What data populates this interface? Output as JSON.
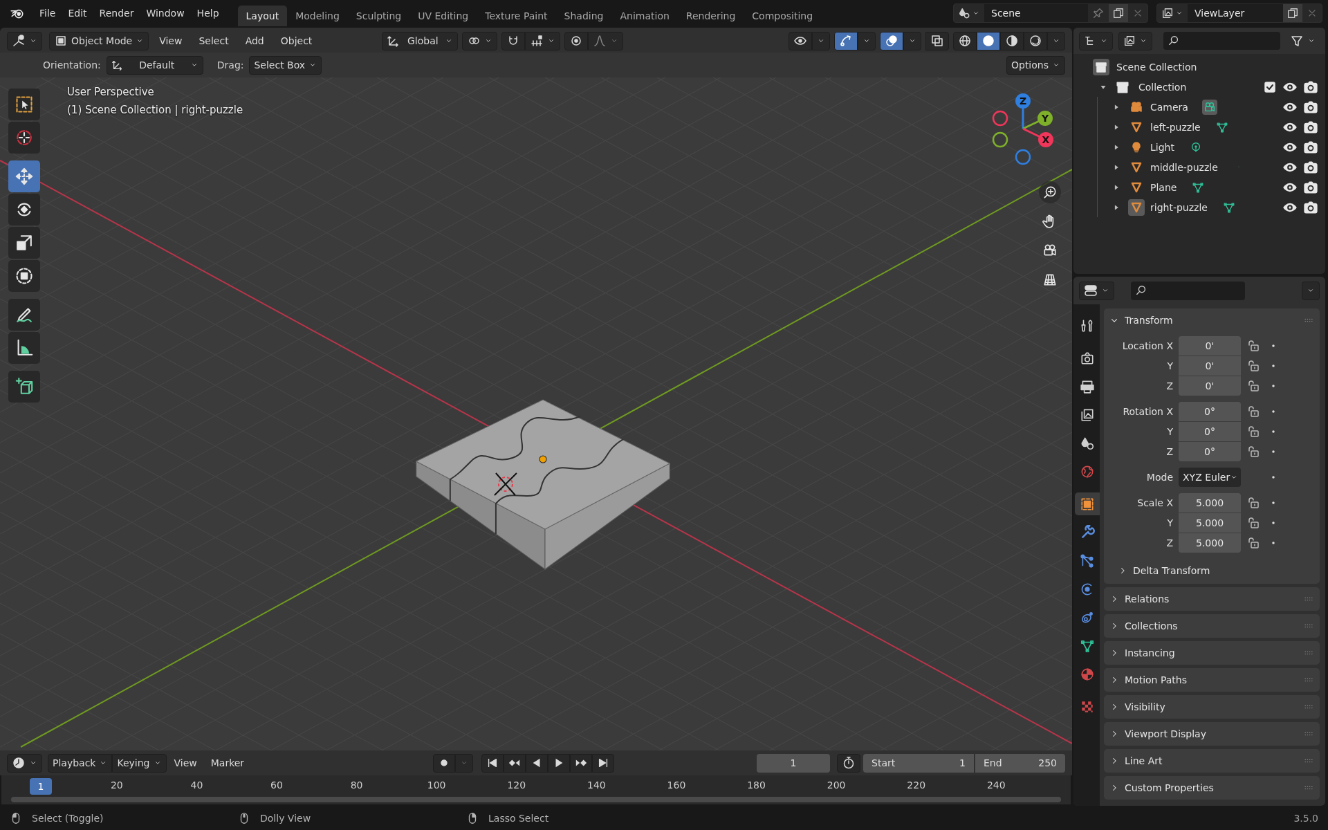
{
  "topbar": {
    "menus": [
      "File",
      "Edit",
      "Render",
      "Window",
      "Help"
    ],
    "workspaces": [
      {
        "label": "Layout",
        "selected": true
      },
      {
        "label": "Modeling",
        "selected": false
      },
      {
        "label": "Sculpting",
        "selected": false
      },
      {
        "label": "UV Editing",
        "selected": false
      },
      {
        "label": "Texture Paint",
        "selected": false
      },
      {
        "label": "Shading",
        "selected": false
      },
      {
        "label": "Animation",
        "selected": false
      },
      {
        "label": "Rendering",
        "selected": false
      },
      {
        "label": "Compositing",
        "selected": false
      }
    ],
    "scene": "Scene",
    "view_layer": "ViewLayer"
  },
  "viewport": {
    "header": {
      "mode": "Object Mode",
      "menus": [
        "View",
        "Select",
        "Add",
        "Object"
      ],
      "orientation": "Global",
      "snap": {
        "on": false
      },
      "proportional": {
        "on": false
      },
      "toggles": [
        {
          "kind": "visibility",
          "on": false
        },
        {
          "kind": "gizmo",
          "on": true
        },
        {
          "kind": "overlay",
          "on": true
        },
        {
          "kind": "xray",
          "on": false
        }
      ],
      "shading": [
        {
          "kind": "wireframe",
          "selected": false
        },
        {
          "kind": "solid",
          "selected": true
        },
        {
          "kind": "material",
          "selected": false
        },
        {
          "kind": "rendered",
          "selected": false
        }
      ]
    },
    "tool_settings": {
      "orientation_label": "Orientation:",
      "orientation": "Default",
      "drag_label": "Drag:",
      "drag": "Select Box",
      "options": "Options"
    },
    "overlay_text": [
      "User Perspective",
      "(1) Scene Collection | right-puzzle"
    ],
    "tool_groups": [
      [
        {
          "kind": "select-box",
          "selected": false
        },
        {
          "kind": "cursor",
          "selected": false
        }
      ],
      [
        {
          "kind": "move",
          "selected": true
        },
        {
          "kind": "rotate",
          "selected": false
        },
        {
          "kind": "scale",
          "selected": false
        },
        {
          "kind": "transform",
          "selected": false
        }
      ],
      [
        {
          "kind": "annotate",
          "selected": false
        },
        {
          "kind": "measure",
          "selected": false
        }
      ],
      [
        {
          "kind": "add-cube",
          "selected": false
        }
      ]
    ],
    "gizmo_axes": [
      {
        "label": "Z",
        "color": "#2f7fe0"
      },
      {
        "label": "Y",
        "color": "#7fb02a"
      },
      {
        "label": "X",
        "color": "#f0365a"
      }
    ]
  },
  "timeline": {
    "menus": [
      {
        "label": "Playback",
        "kind": "dropdown"
      },
      {
        "label": "Keying",
        "kind": "dropdown"
      },
      {
        "label": "View",
        "kind": "menu"
      },
      {
        "label": "Marker",
        "kind": "menu"
      }
    ],
    "auto_keying": {
      "on": false
    },
    "current_frame": "1",
    "start_label": "Start",
    "start": "1",
    "end_label": "End",
    "end": "250",
    "playhead": "1",
    "ticks": [
      "20",
      "40",
      "60",
      "80",
      "100",
      "120",
      "140",
      "160",
      "180",
      "200",
      "220",
      "240"
    ]
  },
  "outliner": {
    "root": "Scene Collection",
    "collections": [
      {
        "name": "Collection",
        "expanded": true,
        "checked": true,
        "children": [
          {
            "name": "Camera",
            "kind": "camera",
            "expanded": false,
            "active": false,
            "data": {
              "kind": "camera",
              "active": true
            }
          },
          {
            "name": "left-puzzle",
            "kind": "mesh",
            "expanded": false,
            "active": false,
            "data": {
              "kind": "mesh",
              "active": false
            }
          },
          {
            "name": "Light",
            "kind": "light",
            "expanded": false,
            "active": false,
            "data": {
              "kind": "light",
              "active": false
            }
          },
          {
            "name": "middle-puzzle",
            "kind": "mesh",
            "expanded": false,
            "active": false,
            "data": {
              "kind": "clipped",
              "active": false
            }
          },
          {
            "name": "Plane",
            "kind": "mesh",
            "expanded": false,
            "active": false,
            "data": {
              "kind": "mesh",
              "active": false
            }
          },
          {
            "name": "right-puzzle",
            "kind": "mesh",
            "expanded": false,
            "active": true,
            "data": {
              "kind": "mesh",
              "active": false
            }
          }
        ]
      }
    ]
  },
  "properties": {
    "tab_groups": [
      [
        {
          "kind": "tool",
          "selected": false
        }
      ],
      [
        {
          "kind": "render",
          "selected": false
        },
        {
          "kind": "output",
          "selected": false
        },
        {
          "kind": "view-layer",
          "selected": false
        },
        {
          "kind": "scene",
          "selected": false
        },
        {
          "kind": "world",
          "selected": false
        }
      ],
      [
        {
          "kind": "object",
          "selected": true
        },
        {
          "kind": "modifiers",
          "selected": false
        },
        {
          "kind": "particles",
          "selected": false
        },
        {
          "kind": "physics",
          "selected": false
        },
        {
          "kind": "constraints",
          "selected": false
        },
        {
          "kind": "data",
          "selected": false
        },
        {
          "kind": "material",
          "selected": false
        }
      ],
      [
        {
          "kind": "texture",
          "selected": false
        }
      ]
    ],
    "panels": [
      {
        "title": "Transform",
        "expanded": true,
        "sections": [
          {
            "kind": "vector",
            "rows": [
              {
                "label": "Location X",
                "value": "0'"
              },
              {
                "label": "Y",
                "value": "0'"
              },
              {
                "label": "Z",
                "value": "0'"
              }
            ]
          },
          {
            "kind": "vector",
            "rows": [
              {
                "label": "Rotation X",
                "value": "0°"
              },
              {
                "label": "Y",
                "value": "0°"
              },
              {
                "label": "Z",
                "value": "0°"
              }
            ]
          },
          {
            "kind": "dropdown",
            "label": "Mode",
            "value": "XYZ Euler"
          },
          {
            "kind": "vector",
            "rows": [
              {
                "label": "Scale X",
                "value": "5.000"
              },
              {
                "label": "Y",
                "value": "5.000"
              },
              {
                "label": "Z",
                "value": "5.000"
              }
            ]
          }
        ],
        "subpanels": [
          {
            "title": "Delta Transform",
            "expanded": false
          }
        ]
      },
      {
        "title": "Relations",
        "expanded": false
      },
      {
        "title": "Collections",
        "expanded": false
      },
      {
        "title": "Instancing",
        "expanded": false
      },
      {
        "title": "Motion Paths",
        "expanded": false
      },
      {
        "title": "Visibility",
        "expanded": false
      },
      {
        "title": "Viewport Display",
        "expanded": false
      },
      {
        "title": "Line Art",
        "expanded": false
      },
      {
        "title": "Custom Properties",
        "expanded": false
      }
    ]
  },
  "status_bar": {
    "hints": [
      {
        "kind": "left",
        "text": "Select (Toggle)"
      },
      {
        "kind": "middle",
        "text": "Dolly View"
      },
      {
        "kind": "right",
        "text": "Lasso Select"
      }
    ],
    "version": "3.5.0"
  }
}
